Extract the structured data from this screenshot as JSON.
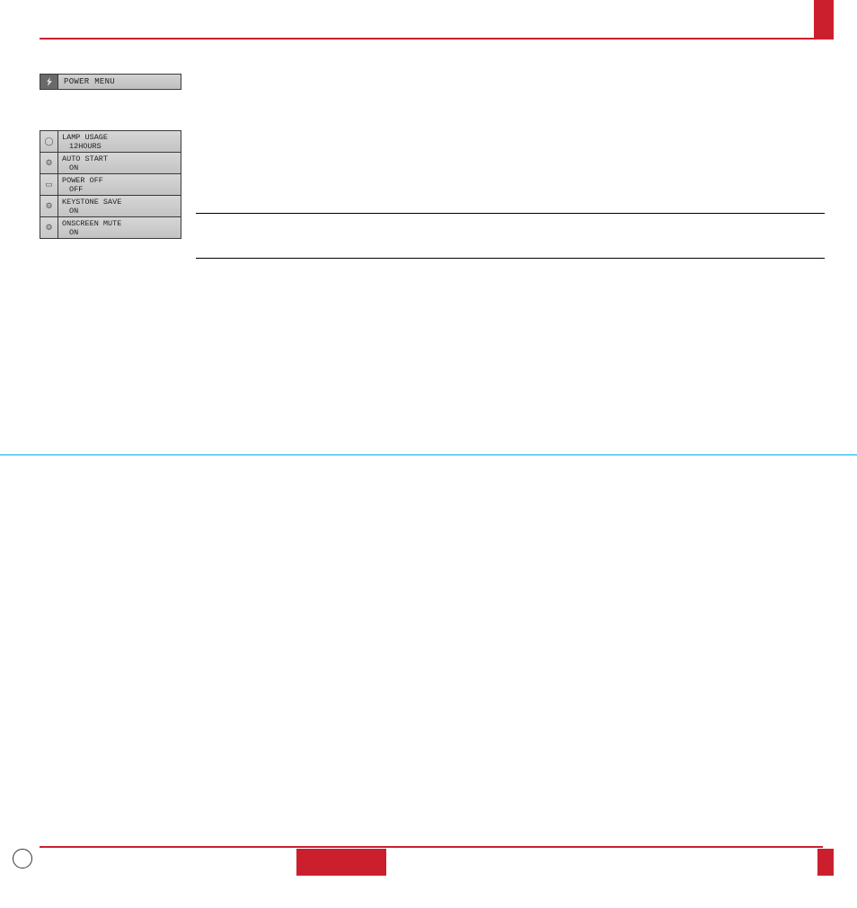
{
  "top_corner": {
    "visible": true
  },
  "power_menu": {
    "header_icon": "power-bolt-icon",
    "header_label": "POWER MENU",
    "items": [
      {
        "icon": "lamp-icon",
        "line1": "LAMP USAGE",
        "line2": "12HOURS"
      },
      {
        "icon": "auto-start-icon",
        "line1": "AUTO START",
        "line2": "ON"
      },
      {
        "icon": "power-off-icon",
        "line1": "POWER OFF",
        "line2": "OFF"
      },
      {
        "icon": "keystone-icon",
        "line1": "KEYSTONE SAVE",
        "line2": "ON"
      },
      {
        "icon": "onscreen-mute-icon",
        "line1": "ONSCREEN MUTE",
        "line2": "ON"
      }
    ]
  },
  "rules": {
    "a": true,
    "b": true
  },
  "footer": {
    "circle": true,
    "center_block": true,
    "right_block": true
  }
}
